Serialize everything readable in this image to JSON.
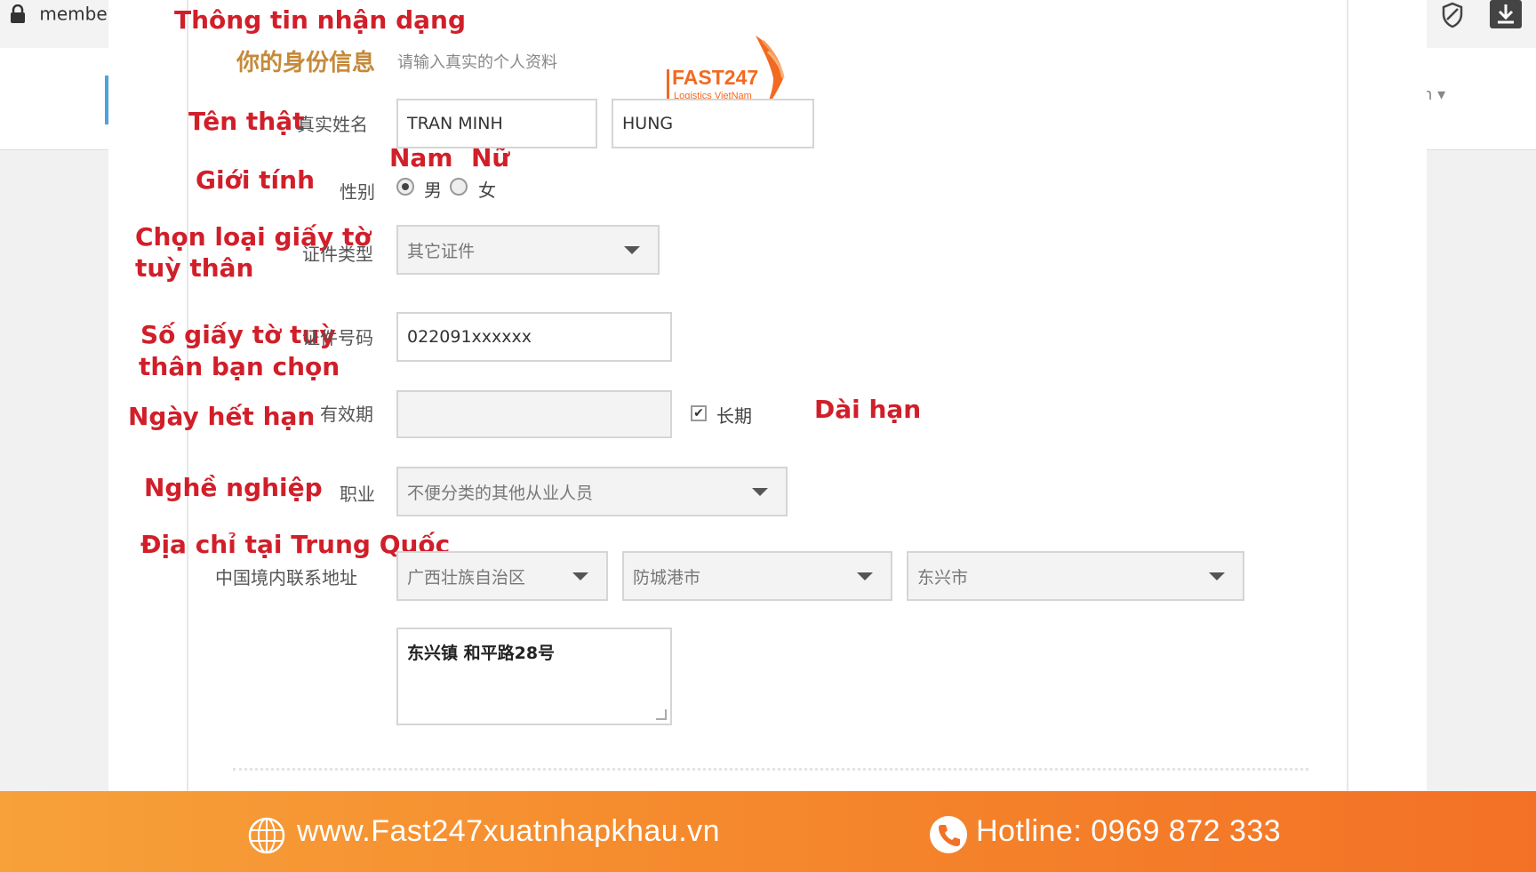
{
  "browser": {
    "url_fragment": "membe"
  },
  "logo": {
    "name": "FAST247",
    "tagline": "Logistics VietNam"
  },
  "section": {
    "title_cn": "你的身份信息",
    "subtitle_cn": "请输入真实的个人资料"
  },
  "annotations": {
    "identity_info": "Thông tin nhận dạng",
    "real_name": "Tên thật",
    "gender": "Giới tính",
    "male": "Nam",
    "female": "Nữ",
    "id_type_line1": "Chọn loại giấy tờ",
    "id_type_line2": "tuỳ thân",
    "id_number_line1": "Số giấy tờ tuỳ",
    "id_number_line2": "thân bạn chọn",
    "expiry": "Ngày hết hạn",
    "long_term": "Dài hạn",
    "occupation": "Nghề nghiệp",
    "address": "Địa chỉ tại Trung Quốc"
  },
  "form": {
    "real_name_label": "真实姓名",
    "surname_value": "TRAN MINH",
    "given_name_value": "HUNG",
    "gender_label": "性别",
    "gender_options": [
      "男",
      "女"
    ],
    "gender_selected": "男",
    "id_type_label": "证件类型",
    "id_type_value": "其它证件",
    "id_number_label": "证件号码",
    "id_number_value": "022091xxxxxx",
    "expiry_label": "有效期",
    "expiry_value": "",
    "long_term_checkbox_label": "长期",
    "long_term_checked": true,
    "occupation_label": "职业",
    "occupation_value": "不便分类的其他从业人员",
    "address_label": "中国境内联系地址",
    "province_value": "广西壮族自治区",
    "city_value": "防城港市",
    "district_value": "东兴市",
    "street_value": "东兴镇 和平路28号"
  },
  "footer": {
    "website": "www.Fast247xuatnhapkhau.vn",
    "hotline": "Hotline: 0969 872 333"
  },
  "colors": {
    "annotation_red": "#d11f2a",
    "brand_orange": "#f26a21",
    "footer_start": "#f7a13a",
    "footer_end": "#f37126"
  }
}
